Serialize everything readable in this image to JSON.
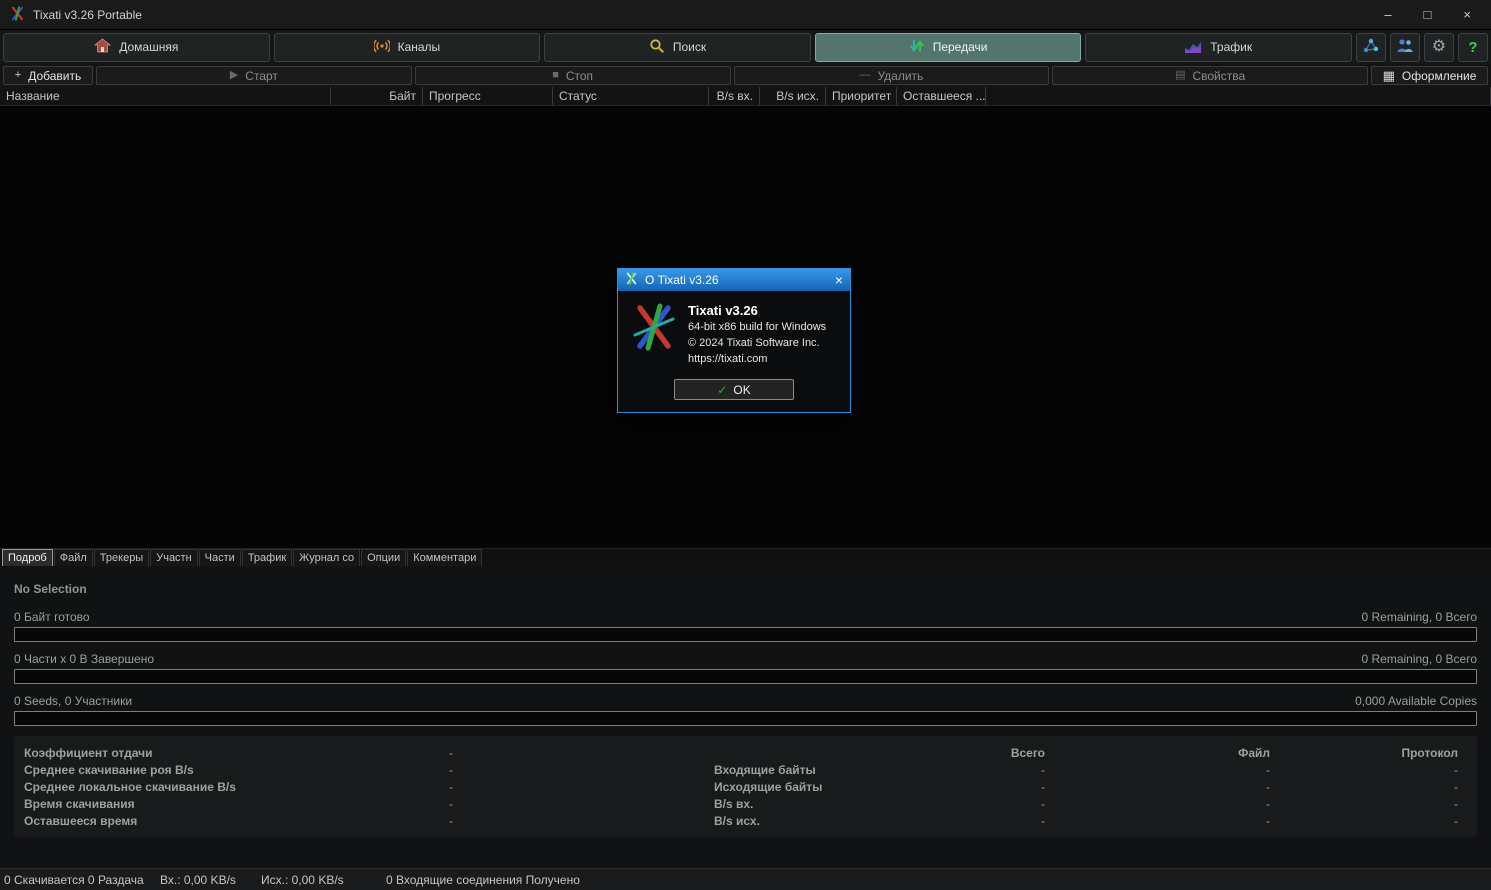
{
  "window": {
    "title": "Tixati v3.26 Portable",
    "controls": {
      "minimize": "–",
      "maximize": "□",
      "close": "×"
    }
  },
  "nav": {
    "tabs": [
      {
        "label": "Домашняя"
      },
      {
        "label": "Каналы"
      },
      {
        "label": "Поиск"
      },
      {
        "label": "Передачи"
      },
      {
        "label": "Трафик"
      }
    ],
    "icon_glyphs": {
      "gear": "⚙",
      "help": "?"
    }
  },
  "toolbar": {
    "add": "Добавить",
    "start": "Старт",
    "stop": "Стоп",
    "remove": "Удалить",
    "properties": "Свойства",
    "layout": "Оформление",
    "icons": {
      "add": "+",
      "start": "▶",
      "stop": "■",
      "remove": "—",
      "properties": "▤",
      "layout": "▦"
    }
  },
  "table": {
    "columns": [
      "Название",
      "Байт",
      "Прогресс",
      "Статус",
      "B/s вх.",
      "B/s исх.",
      "Приоритет",
      "Оставшееся ..."
    ]
  },
  "dialog": {
    "title": "О Tixati v3.26",
    "close": "×",
    "app_name": "Tixati v3.26",
    "build": "64-bit x86 build for Windows",
    "copyright": "© 2024 Tixati Software Inc.",
    "url": "https://tixati.com",
    "ok_label": "OK",
    "check": "✓"
  },
  "detail_tabs": [
    {
      "label": "Подроб"
    },
    {
      "label": "Файл"
    },
    {
      "label": "Трекеры"
    },
    {
      "label": "Участн"
    },
    {
      "label": "Части"
    },
    {
      "label": "Трафик"
    },
    {
      "label": "Журнал со"
    },
    {
      "label": "Опции"
    },
    {
      "label": "Комментари"
    }
  ],
  "details": {
    "no_selection": "No Selection",
    "rows": [
      {
        "left": "0 Байт готово",
        "right": "0 Remaining,  0 Всего"
      },
      {
        "left": "0 Части  x  0 В Завершено",
        "right": "0 Remaining,  0 Всего"
      },
      {
        "left": "0 Seeds, 0 Участники",
        "right": "0,000 Available Copies"
      }
    ]
  },
  "stats": {
    "col_headers": [
      "Всего",
      "Файл",
      "Протокол"
    ],
    "left_rows": [
      {
        "label": "Коэффициент отдачи",
        "value": "-"
      },
      {
        "label": "Среднее скачивание роя B/s",
        "value": "-"
      },
      {
        "label": "Среднее локальное скачивание B/s",
        "value": "-"
      },
      {
        "label": "Время скачивания",
        "value": "-"
      },
      {
        "label": "Оставшееся время",
        "value": "-"
      }
    ],
    "right_rows": [
      {
        "label": "Входящие байты",
        "total": "-",
        "file": "-",
        "protocol": "-"
      },
      {
        "label": "Исходящие байты",
        "total": "-",
        "file": "-",
        "protocol": "-"
      },
      {
        "label": "B/s вх.",
        "total": "-",
        "file": "-",
        "protocol": "-"
      },
      {
        "label": "B/s исх.",
        "total": "-",
        "file": "-",
        "protocol": "-"
      }
    ]
  },
  "statusbar": {
    "transfers": "0 Скачивается  0 Раздача",
    "incoming": "Вх.: 0,00 KB/s",
    "outgoing": "Исх.: 0,00 KB/s",
    "connections": "0 Входящие соединения Получено"
  },
  "colors": {
    "active_tab": "#54756e",
    "dialog_title_blue": "#1e7fd4",
    "ok_check_green": "#2fae4a"
  }
}
